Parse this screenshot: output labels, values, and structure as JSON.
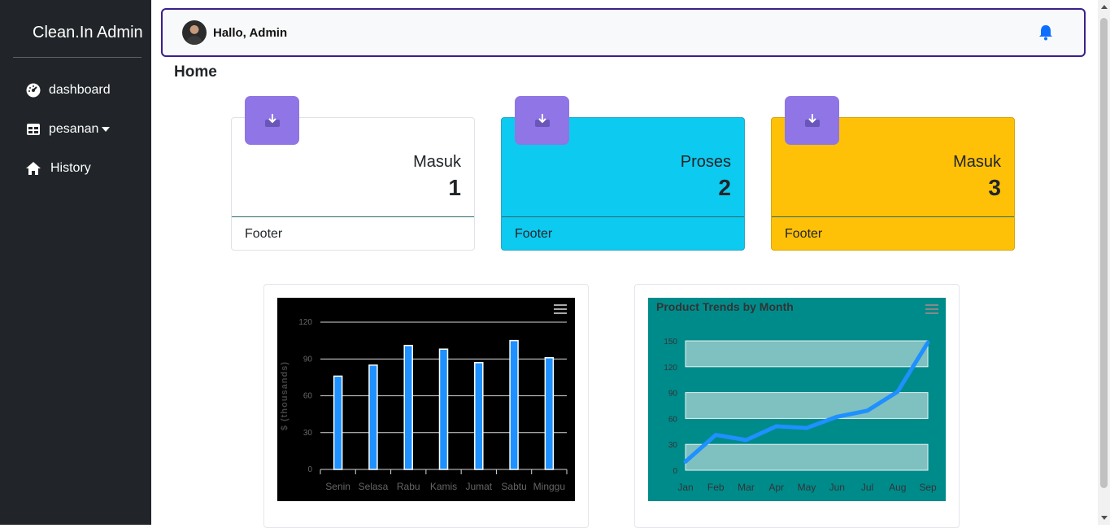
{
  "sidebar": {
    "brand": "Clean.In Admin",
    "items": [
      {
        "label": "dashboard",
        "icon": "dashboard-gauge-icon"
      },
      {
        "label": "pesanan",
        "icon": "table-grid-icon"
      },
      {
        "label": "History",
        "icon": "home-icon"
      }
    ]
  },
  "topbar": {
    "greeting": "Hallo, Admin"
  },
  "page": {
    "title": "Home"
  },
  "cards": [
    {
      "title": "Masuk",
      "value": "1",
      "footer": "Footer",
      "bg": "#ffffff"
    },
    {
      "title": "Proses",
      "value": "2",
      "footer": "Footer",
      "bg": "#0dcaf0"
    },
    {
      "title": "Masuk",
      "value": "3",
      "footer": "Footer",
      "bg": "#ffc107"
    }
  ],
  "chart_data": [
    {
      "type": "bar",
      "title": "",
      "categories": [
        "Senin",
        "Selasa",
        "Rabu",
        "Kamis",
        "Jumat",
        "Sabtu",
        "Minggu"
      ],
      "values": [
        76,
        85,
        101,
        98,
        87,
        105,
        91
      ],
      "ylabel": "$ (thousands)",
      "ylim": [
        0,
        120
      ],
      "yticks": [
        "0",
        "30",
        "60",
        "90",
        "120"
      ],
      "grid": true,
      "colors": {
        "background": "#000000",
        "bar": "#1e90ff"
      }
    },
    {
      "type": "line",
      "title": "Product Trends by Month",
      "x": [
        "Jan",
        "Feb",
        "Mar",
        "Apr",
        "May",
        "Jun",
        "Jul",
        "Aug",
        "Sep"
      ],
      "values": [
        10,
        41,
        35,
        51,
        49,
        62,
        69,
        91,
        148
      ],
      "ylim": [
        0,
        150
      ],
      "yticks": [
        "0",
        "30",
        "60",
        "90",
        "120",
        "150"
      ],
      "grid": true,
      "colors": {
        "background": "#008b8b",
        "line": "#1e90ff",
        "band": "#7fc0c0"
      }
    }
  ]
}
